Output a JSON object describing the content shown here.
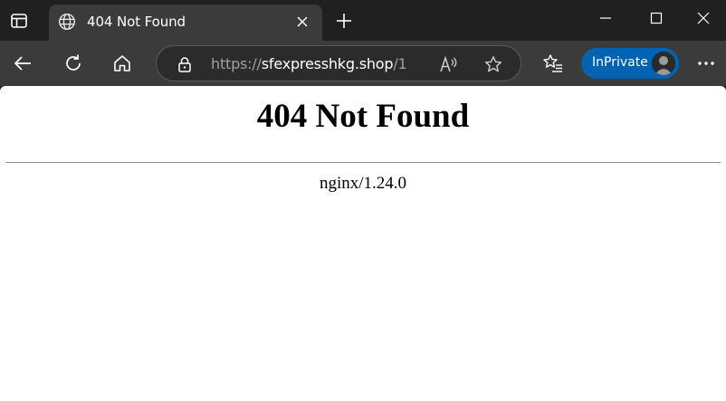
{
  "browser": {
    "tab": {
      "title": "404 Not Found"
    },
    "url": {
      "scheme": "https://",
      "host": "sfexpresshkg.shop",
      "path": "/1"
    },
    "profile": {
      "label": "InPrivate"
    },
    "accent_color": "#0063b1"
  },
  "page": {
    "heading": "404 Not Found",
    "server_info": "nginx/1.24.0"
  }
}
